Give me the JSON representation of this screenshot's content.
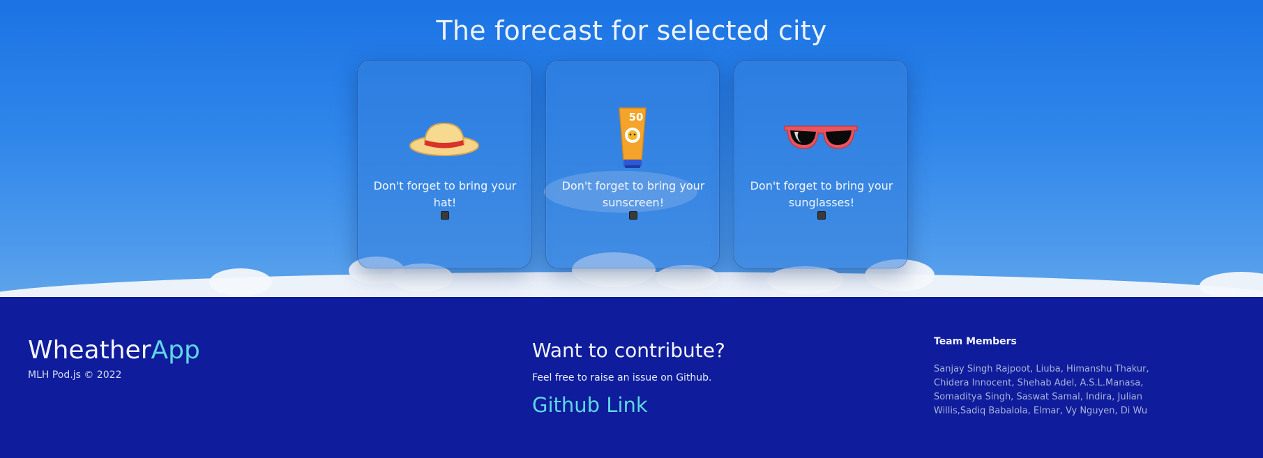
{
  "forecast": {
    "title": "The forecast for selected city",
    "cards": [
      {
        "icon": "sun-hat-icon",
        "message": "Don't forget to bring your hat!"
      },
      {
        "icon": "sunscreen-icon",
        "message": "Don't forget to bring your sunscreen!",
        "icon_label": "50"
      },
      {
        "icon": "sunglasses-icon",
        "message": "Don't forget to bring your sunglasses!"
      }
    ]
  },
  "footer": {
    "brand_main": "Wheather",
    "brand_accent": "App",
    "copyright": "MLH Pod.js © 2022",
    "contribute_heading": "Want to contribute?",
    "contribute_text": "Feel free to raise an issue on Github.",
    "github_link": "Github Link",
    "team_heading": "Team Members",
    "team_members": "Sanjay Singh Rajpoot, Liuba, Himanshu Thakur, Chidera Innocent, Shehab Adel, A.S.L.Manasa, Somaditya Singh, Saswat Samal, Indira, Julian Willis,Sadiq Babalola, Elmar, Vy Nguyen, Di Wu"
  },
  "colors": {
    "footer_bg": "#0f1c9b",
    "accent": "#5fd7e6",
    "sky": "#1b73e4"
  }
}
